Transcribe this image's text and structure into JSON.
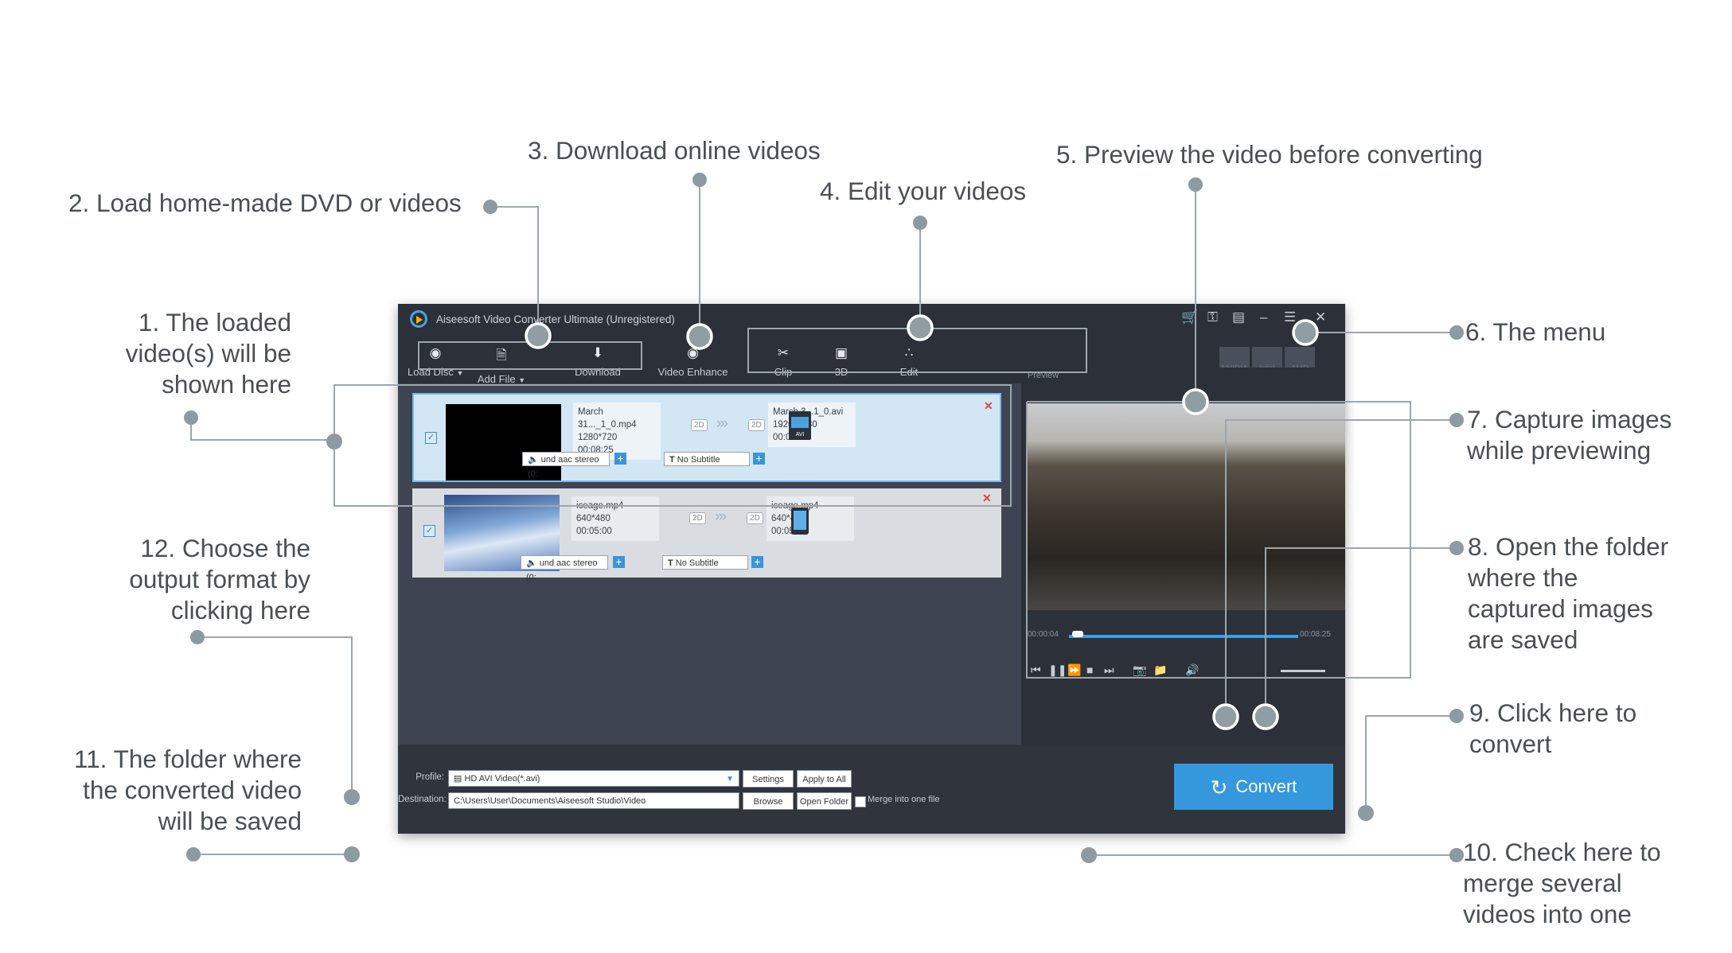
{
  "callouts": {
    "c1": [
      "1. The loaded",
      "video(s) will be",
      "shown here"
    ],
    "c2": "2. Load home-made DVD or videos",
    "c3": "3. Download online videos",
    "c4": "4. Edit your videos",
    "c5": "5. Preview the video before converting",
    "c6": "6. The menu",
    "c7": [
      "7. Capture images",
      "while previewing"
    ],
    "c8": [
      "8. Open the folder",
      "where the",
      "captured images",
      "are saved"
    ],
    "c9": [
      "9. Click here to",
      "convert"
    ],
    "c10": [
      "10. Check here to",
      "merge several",
      "videos into one"
    ],
    "c11": [
      "11. The folder where",
      "the converted video",
      "will be saved"
    ],
    "c12": [
      "12. Choose the",
      "output format by",
      "clicking here"
    ]
  },
  "app": {
    "title": "Aiseesoft Video Converter Ultimate (Unregistered)",
    "toolbar": {
      "load_disc": "Load Disc",
      "add_file": "Add File",
      "download": "Download",
      "video_enhance": "Video Enhance",
      "clip": "Clip",
      "three_d": "3D",
      "edit": "Edit"
    },
    "hw": [
      "NVIDIA",
      "Intel",
      "AMD"
    ],
    "files": [
      {
        "src_name": "March 31..._1_0.mp4",
        "src_res": "1280*720",
        "src_dur": "00:08:25",
        "dst_name": "March 3...1_0.avi",
        "dst_res": "1920*1080",
        "dst_dur": "00:08:25",
        "audio": "und aac stereo (0:",
        "subtitle": "No Subtitle",
        "format_icon": "hd-avi-format-icon"
      },
      {
        "src_name": "iceage.mp4",
        "src_res": "640*480",
        "src_dur": "00:05:00",
        "dst_name": "iceage.mp4",
        "dst_res": "640*480",
        "dst_dur": "00:05:00",
        "audio": "und aac stereo (0:",
        "subtitle": "No Subtitle",
        "format_icon": "tablet-format-icon"
      }
    ],
    "tag_2d": "2D",
    "preview": {
      "label": "Preview",
      "time_current": "00:00:04",
      "time_total": "00:08:25",
      "progress_fraction": 0.02
    },
    "bottom": {
      "profile_label": "Profile:",
      "profile_value": "HD AVI Video(*.avi)",
      "settings": "Settings",
      "apply_all": "Apply to All",
      "destination_label": "Destination:",
      "destination_value": "C:\\Users\\User\\Documents\\Aiseesoft Studio\\Video",
      "browse": "Browse",
      "open_folder": "Open Folder",
      "merge": "Merge into one file",
      "convert": "Convert"
    }
  },
  "colors": {
    "accent": "#3598dc",
    "callout_text": "#4a4f54",
    "connector": "#9ba7ac",
    "close_x": "#e0453b"
  }
}
